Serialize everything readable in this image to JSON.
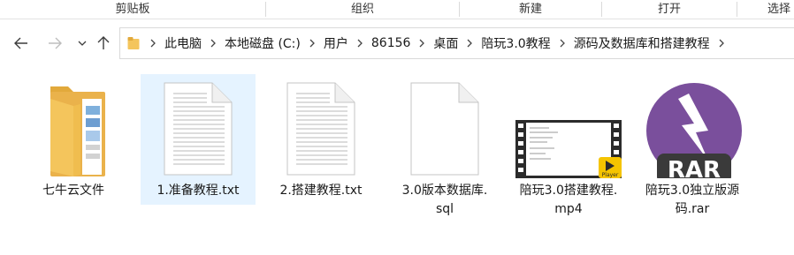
{
  "ribbon": {
    "groups": [
      "剪贴板",
      "组织",
      "新建",
      "打开",
      "选择"
    ]
  },
  "nav": {
    "back_icon": "arrow-left-icon",
    "forward_icon": "arrow-right-icon",
    "recent_icon": "chevron-down-icon",
    "up_icon": "arrow-up-icon",
    "breadcrumbs": [
      "此电脑",
      "本地磁盘 (C:)",
      "用户",
      "86156",
      "桌面",
      "陪玩3.0教程",
      "源码及数据库和搭建教程"
    ]
  },
  "colors": {
    "selection": "#e5f3ff",
    "folder": "#f4c55c",
    "rar_purple": "#7a4f9c"
  },
  "files": [
    {
      "name": "七牛云文件",
      "icon": "folder-icon",
      "selected": false
    },
    {
      "name": "1.准备教程.txt",
      "icon": "text-file-icon",
      "selected": true
    },
    {
      "name": "2.搭建教程.txt",
      "icon": "text-file-icon",
      "selected": false
    },
    {
      "name_line1": "3.0版本数据库.",
      "name_line2": "sql",
      "icon": "blank-file-icon",
      "selected": false
    },
    {
      "name_line1": "陪玩3.0搭建教程.",
      "name_line2": "mp4",
      "icon": "video-file-icon",
      "selected": false,
      "badge": "Player"
    },
    {
      "name_line1": "陪玩3.0独立版源",
      "name_line2": "码.rar",
      "icon": "rar-archive-icon",
      "selected": false,
      "badge": "RAR"
    }
  ]
}
